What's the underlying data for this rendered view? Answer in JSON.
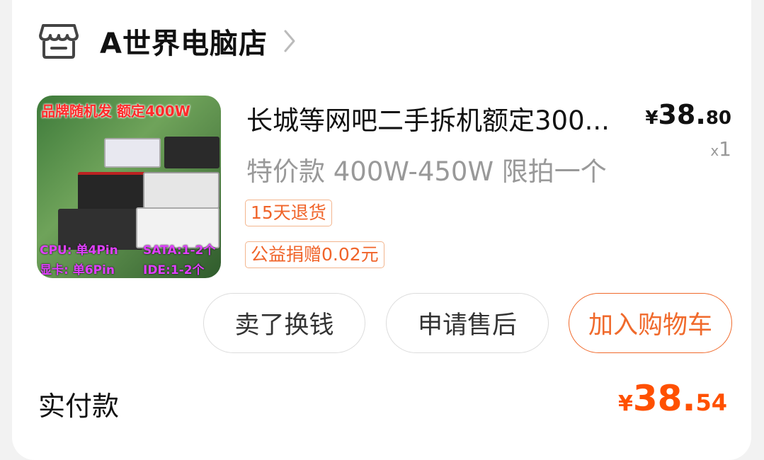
{
  "shop": {
    "name": "A世界电脑店",
    "icon": "store-icon",
    "chevron_icon": "chevron-right-icon"
  },
  "item": {
    "title": "长城等网吧二手拆机额定300...",
    "spec": "特价款 400W-450W 限拍一个",
    "price_currency": "¥",
    "price_int": "38.",
    "price_dec": "80",
    "qty_prefix": "x",
    "qty": "1",
    "tags": [
      "15天退货",
      "公益捐赠0.02元"
    ],
    "thumbnail": {
      "banner": "品牌随机发 额定400W",
      "cpu": "CPU: 单4Pin",
      "sata": "SATA:1-2个",
      "gpu": "显卡: 单6Pin",
      "ide": "IDE:1-2个"
    }
  },
  "actions": {
    "sell": "卖了换钱",
    "after_sales": "申请售后",
    "add_to_cart": "加入购物车"
  },
  "payment": {
    "label": "实付款",
    "currency": "¥",
    "int": "38.",
    "dec": "54"
  },
  "colors": {
    "accent": "#ff5000",
    "cart_button": "#f06a2c",
    "tag_text": "#f0642a",
    "tag_border": "#f3b58e",
    "muted_text": "#999999"
  }
}
